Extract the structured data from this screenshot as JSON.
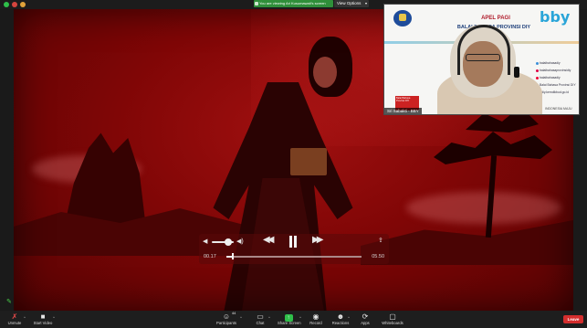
{
  "topbar": {
    "share_banner": "You are viewing Ari Kusumawati's screen",
    "view_options": "View Options",
    "traffic_colors": [
      "#2fbf4a",
      "#d4453e",
      "#e0a23a"
    ]
  },
  "player": {
    "time_elapsed": "00.17",
    "time_total": "05.50",
    "progress_fraction": 0.05,
    "volume_fraction": 0.75,
    "icons": [
      "volume-low-icon",
      "volume-high-icon",
      "rewind-icon",
      "pause-icon",
      "fast-forward-icon",
      "share-icon"
    ]
  },
  "camera": {
    "title_line1": "APEL PAGI",
    "title_line2": "BALAI BAHASA PROVINSI DIY",
    "brand": "bby",
    "social": [
      "balaibahasadiy",
      "balaibahasaprovinsidiy",
      "balaibahasadiy",
      "Balai Bahasa Provinsi DIY",
      "balaibahasadiy.kemdikbud.go.id"
    ],
    "sign_text": "Balai Bahasa Provinsi DIY",
    "footer_mark": "INDONESIA MAJU",
    "participant_name": "Sri Sabakti - BBY"
  },
  "toolbar": {
    "unmute": "Unmute",
    "start_video": "Start Video",
    "participants": "Participants",
    "participants_count": "44",
    "chat": "Chat",
    "share_screen": "Share Screen",
    "record": "Record",
    "reactions": "Reactions",
    "apps": "Apps",
    "whiteboards": "Whiteboards",
    "leave": "Leave"
  },
  "colors": {
    "accent_green": "#2fbf4a",
    "leave_red": "#d42e2e",
    "stage_red": "#9a0c0c"
  }
}
